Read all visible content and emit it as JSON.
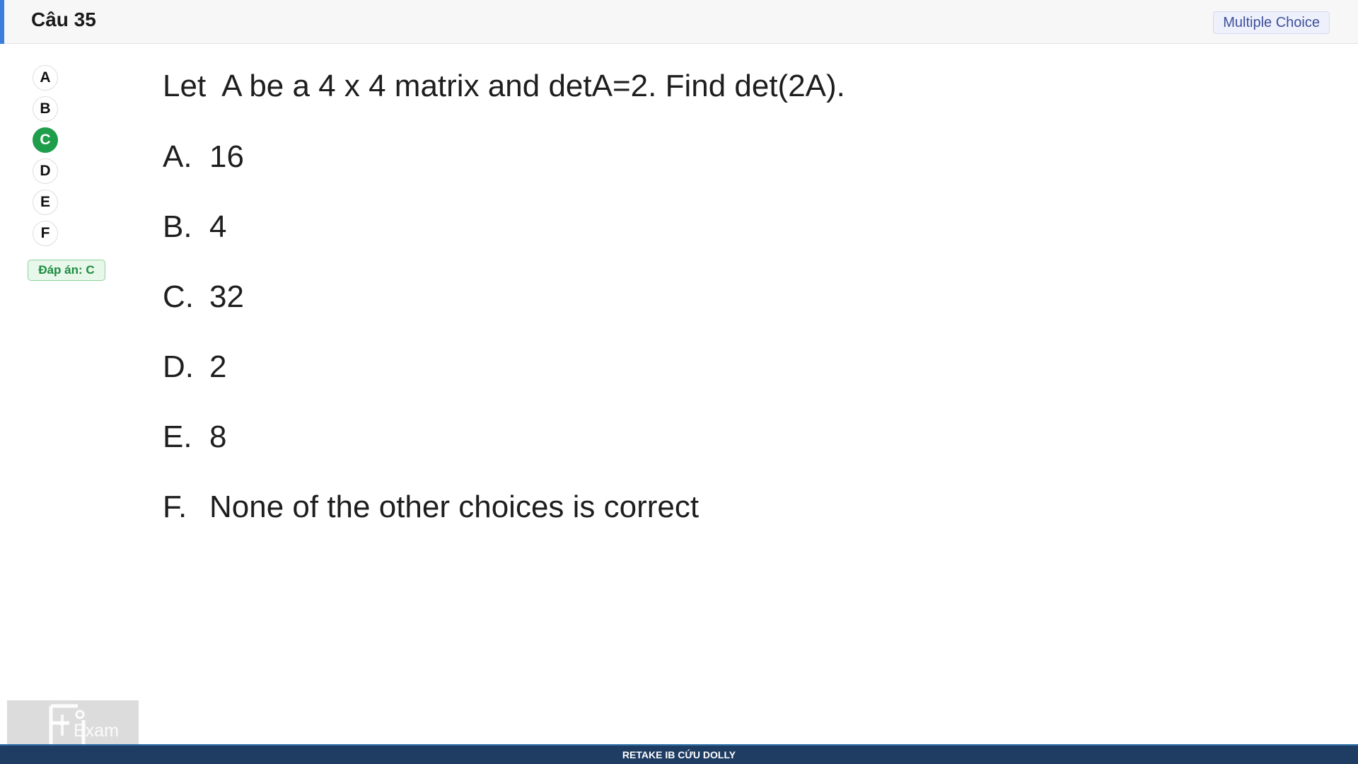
{
  "header": {
    "title": "Câu 35",
    "type_badge": "Multiple Choice",
    "accent_color": "#3b7ddd"
  },
  "choices": {
    "items": [
      "A",
      "B",
      "C",
      "D",
      "E",
      "F"
    ],
    "selected": "C",
    "selected_color": "#1e9e4a"
  },
  "answer": {
    "label": "Đáp án: C"
  },
  "question": {
    "stem": "Let  A be a 4 x 4 matrix and detA=2. Find det(2A).",
    "options": [
      {
        "letter": "A.",
        "text": "16"
      },
      {
        "letter": "B.",
        "text": "4"
      },
      {
        "letter": "C.",
        "text": "32"
      },
      {
        "letter": "D.",
        "text": "2"
      },
      {
        "letter": "E.",
        "text": "8"
      },
      {
        "letter": "F.",
        "text": "None of the other choices is correct"
      }
    ]
  },
  "logo": {
    "icon": "fu-exam-logo",
    "text": "Exam"
  },
  "footer": {
    "text": "RETAKE IB CỨU DOLLY",
    "color": "#1f3d63"
  }
}
